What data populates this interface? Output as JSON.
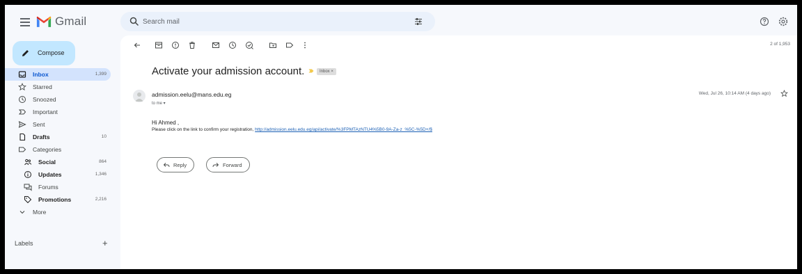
{
  "app": {
    "name": "Gmail"
  },
  "search": {
    "placeholder": "Search mail"
  },
  "sidebar": {
    "compose_label": "Compose",
    "items": [
      {
        "label": "Inbox",
        "count": "1,399",
        "icon": "inbox-icon",
        "active": true
      },
      {
        "label": "Starred",
        "count": "",
        "icon": "star-icon"
      },
      {
        "label": "Snoozed",
        "count": "",
        "icon": "clock-icon"
      },
      {
        "label": "Important",
        "count": "",
        "icon": "important-icon"
      },
      {
        "label": "Sent",
        "count": "",
        "icon": "send-icon"
      },
      {
        "label": "Drafts",
        "count": "10",
        "icon": "draft-icon",
        "bold": true
      },
      {
        "label": "Categories",
        "count": "",
        "icon": "label-icon"
      },
      {
        "label": "Social",
        "count": "864",
        "icon": "people-icon",
        "bold": true,
        "sub": true
      },
      {
        "label": "Updates",
        "count": "1,346",
        "icon": "info-icon",
        "bold": true,
        "sub": true
      },
      {
        "label": "Forums",
        "count": "",
        "icon": "forum-icon",
        "sub": true
      },
      {
        "label": "Promotions",
        "count": "2,216",
        "icon": "tag-icon",
        "bold": true,
        "sub": true
      },
      {
        "label": "More",
        "count": "",
        "icon": "chevron-down-icon"
      }
    ],
    "labels_header": "Labels",
    "labels_add": "+"
  },
  "toolbar": {
    "pager": "2 of 1,953"
  },
  "email": {
    "subject": "Activate your admission account.",
    "label_chip": "Inbox ×",
    "sender": "admission.eelu@mans.edu.eg",
    "to": "to me ▾",
    "date": "Wed, Jul 26, 10:14 AM (4 days ago)",
    "greeting": "Hi Ahmed ,",
    "body_text": "Please click on the link to confirm your registration,",
    "link": "http://admission.eelu.edu.eg/api/activate/%3FPMTAzNTU4%5B0-9A-Za-z_%5C-%5D+/$",
    "reply_label": "Reply",
    "forward_label": "Forward"
  },
  "colors": {
    "accent": "#0b57d0",
    "compose_bg": "#c2e7ff",
    "active_bg": "#d3e3fd",
    "search_bg": "#eaf1fb"
  }
}
